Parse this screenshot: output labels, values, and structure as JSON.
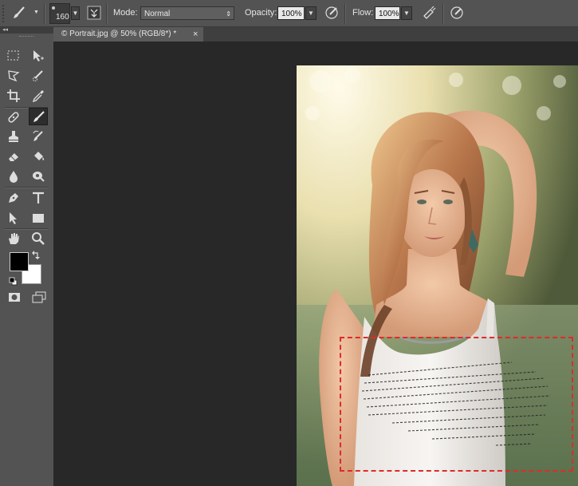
{
  "options_bar": {
    "brush_size": "160",
    "mode_label": "Mode:",
    "mode_value": "Normal",
    "opacity_label": "Opacity:",
    "opacity_value": "100%",
    "flow_label": "Flow:",
    "flow_value": "100%"
  },
  "document_tab": {
    "title": "© Portrait.jpg @ 50% (RGB/8*) *",
    "close": "×"
  },
  "toolbox": {
    "collapse_glyph": "◂◂",
    "active_tool": "brush-tool",
    "foreground_color": "#000000",
    "background_color": "#ffffff"
  },
  "colors": {
    "panel": "#535353",
    "canvas": "#282828",
    "selection_border": "#e02a2a"
  }
}
